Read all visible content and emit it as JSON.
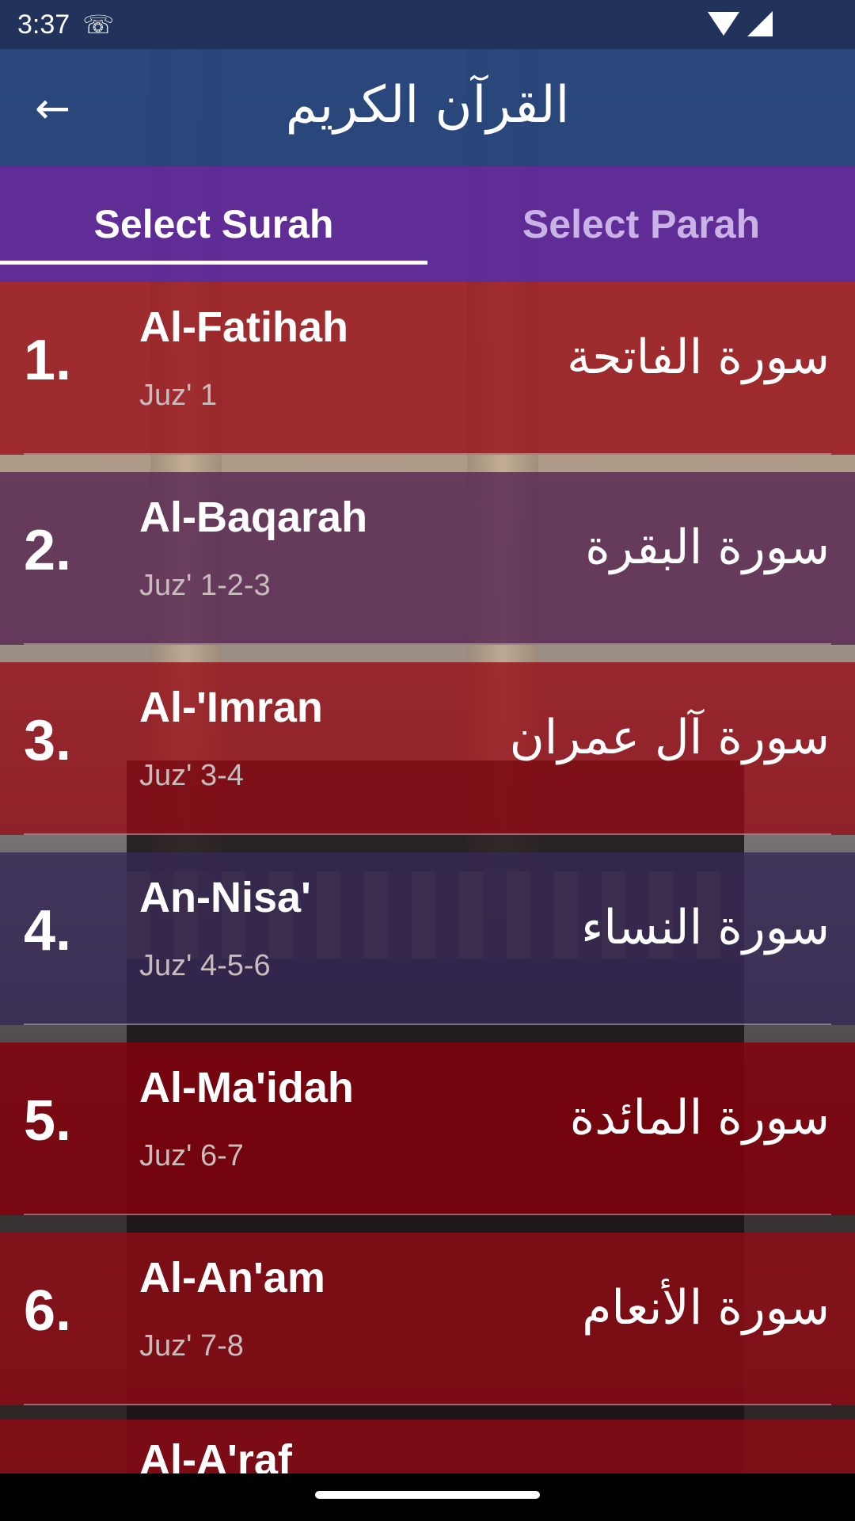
{
  "status_bar": {
    "time": "3:37"
  },
  "app_bar": {
    "title": "القرآن الكريم",
    "back_icon": "arrow-left-icon"
  },
  "tabs": [
    {
      "label": "Select Surah",
      "selected": true
    },
    {
      "label": "Select Parah",
      "selected": false
    }
  ],
  "surahs": [
    {
      "number": "1.",
      "english": "Al-Fatihah",
      "juz": "Juz' 1",
      "arabic": "سورة الفاتحة"
    },
    {
      "number": "2.",
      "english": "Al-Baqarah",
      "juz": "Juz' 1-2-3",
      "arabic": "سورة البقرة"
    },
    {
      "number": "3.",
      "english": "Al-'Imran",
      "juz": "Juz' 3-4",
      "arabic": "سورة آل عمران"
    },
    {
      "number": "4.",
      "english": "An-Nisa'",
      "juz": "Juz' 4-5-6",
      "arabic": "سورة النساء"
    },
    {
      "number": "5.",
      "english": "Al-Ma'idah",
      "juz": "Juz' 6-7",
      "arabic": "سورة المائدة"
    },
    {
      "number": "6.",
      "english": "Al-An'am",
      "juz": "Juz' 7-8",
      "arabic": "سورة الأنعام"
    },
    {
      "number": "",
      "english": "Al-A'raf",
      "juz": "",
      "arabic": ""
    }
  ],
  "colors": {
    "status_bar": "#142855",
    "app_bar": "#193c78",
    "tab_bar": "#582296",
    "row_red": "#960a14",
    "row_purple": "#552350"
  }
}
